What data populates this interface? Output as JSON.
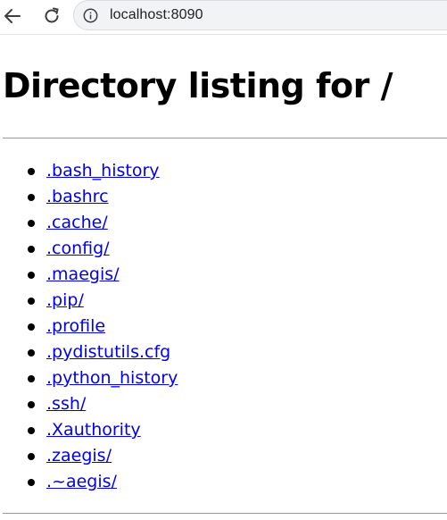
{
  "browser": {
    "url": "localhost:8090",
    "icons": {
      "back": "arrow-left-icon",
      "reload": "reload-icon",
      "info": "info-circle-icon"
    }
  },
  "page": {
    "title": "Directory listing for /",
    "entries": [
      ".bash_history",
      ".bashrc",
      ".cache/",
      ".config/",
      ".maegis/",
      ".pip/",
      ".profile",
      ".pydistutils.cfg",
      ".python_history",
      ".ssh/",
      ".Xauthority",
      ".zaegis/",
      ".~aegis/"
    ]
  },
  "colors": {
    "link": "#0000ee",
    "rule": "#9a9a9a"
  }
}
